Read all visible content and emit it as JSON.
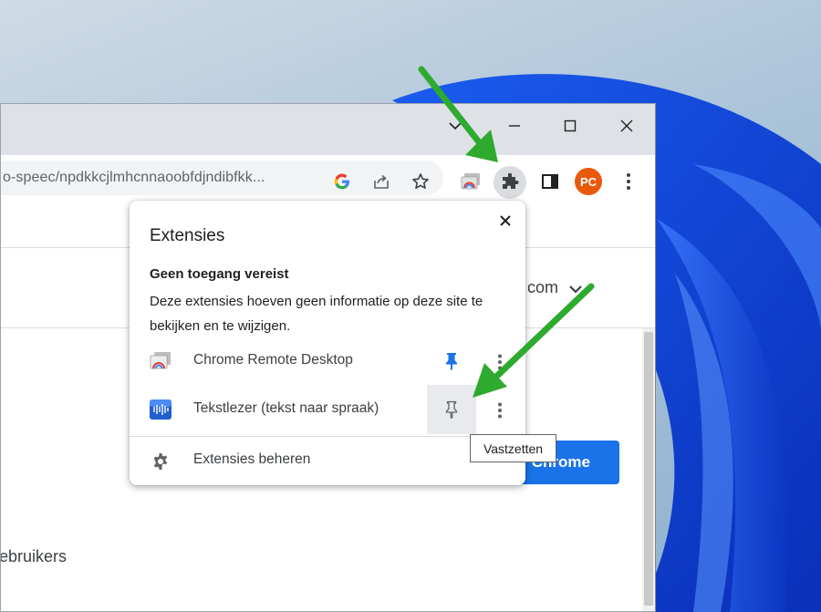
{
  "browser": {
    "url_text": "o-speec/npdkkcjlmhcnnaoobfdjndibfkk...",
    "profile_initials": "PC",
    "profile_color": "#e8590c",
    "accent_color": "#1a73e8"
  },
  "page": {
    "domain_fragment": "com",
    "chrome_button_label": "Chrome",
    "users_fragment": "ebruikers"
  },
  "extensions_popup": {
    "title": "Extensies",
    "section_heading": "Geen toegang vereist",
    "section_description": "Deze extensies hoeven geen informatie op deze site te bekijken en te wijzigen.",
    "items": [
      {
        "name": "Chrome Remote Desktop",
        "pinned": true,
        "icon": "chrome-remote-desktop-icon"
      },
      {
        "name": "Tekstlezer (tekst naar spraak)",
        "pinned": false,
        "icon": "text-reader-icon"
      }
    ],
    "manage_label": "Extensies beheren"
  },
  "tooltip": {
    "text": "Vastzetten"
  },
  "annotations": {
    "arrow_color": "#2eaa2e"
  }
}
